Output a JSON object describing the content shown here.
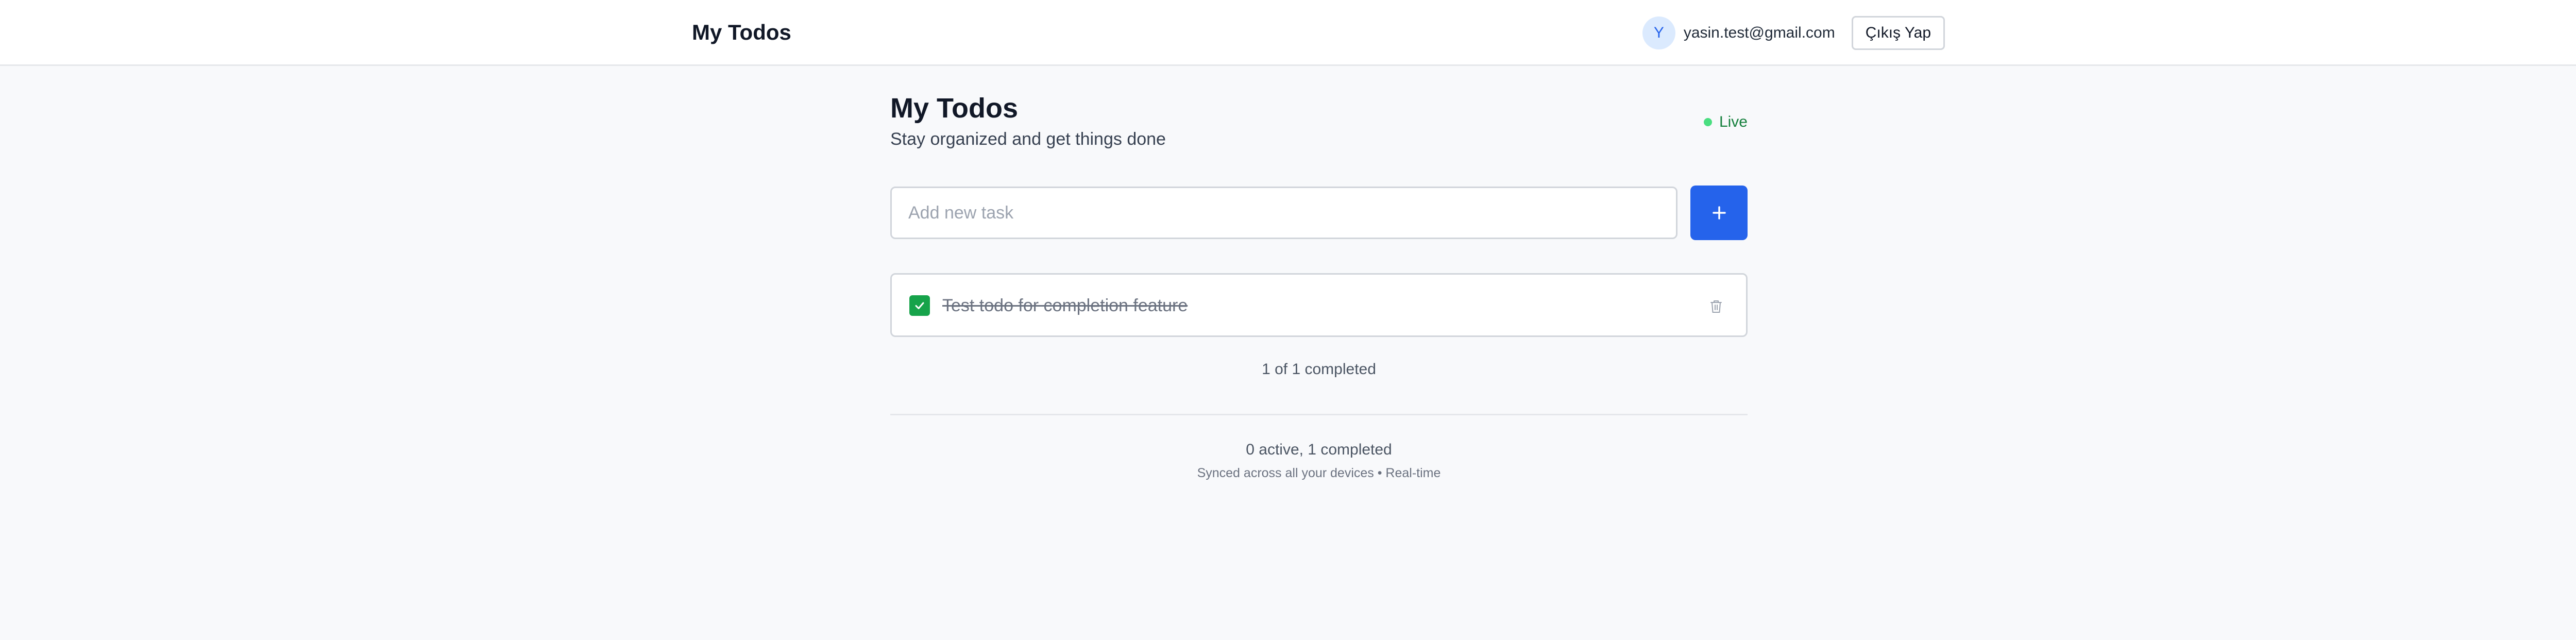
{
  "header": {
    "brand": "My Todos",
    "user": {
      "avatar_initial": "Y",
      "email": "yasin.test@gmail.com"
    },
    "logout_label": "Çıkış Yap"
  },
  "main": {
    "title": "My Todos",
    "subtitle": "Stay organized and get things done",
    "status": {
      "label": "Live",
      "color": "#4ade80"
    },
    "new_task": {
      "placeholder": "Add new task",
      "value": "",
      "add_icon": "plus-icon",
      "button_color": "#2563eb"
    },
    "todos": [
      {
        "text": "Test todo for completion feature",
        "completed": true,
        "check_icon": "check-icon",
        "delete_icon": "trash-icon"
      }
    ],
    "progress_text": "1 of 1 completed",
    "footer": {
      "counts": "0 active, 1 completed",
      "sync_text": "Synced across all your devices • Real-time"
    }
  },
  "colors": {
    "accent": "#2563eb",
    "success": "#16a34a",
    "background": "#f8f9fb"
  }
}
